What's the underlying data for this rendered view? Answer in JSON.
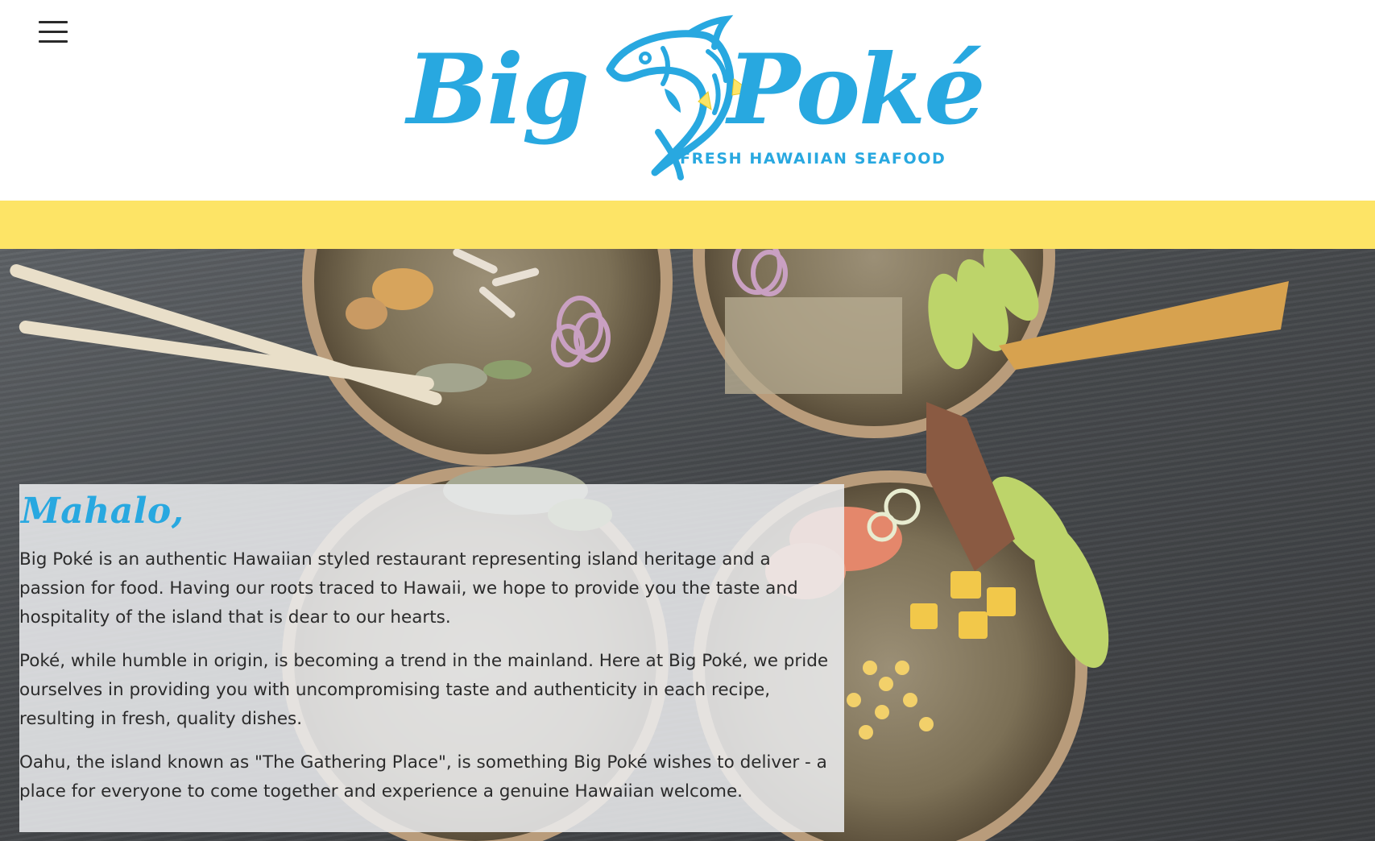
{
  "header": {
    "menu_icon": "hamburger-menu-icon",
    "logo": {
      "word_left": "Big",
      "word_right": "Poké",
      "tagline": "FRESH HAWAIIAN SEAFOOD",
      "fish_icon": "fish-logo-icon"
    }
  },
  "colors": {
    "brand_blue": "#28a8e0",
    "band_yellow": "#fde466",
    "panel_bg": "#eceef0",
    "text": "#2b2b2b"
  },
  "about": {
    "heading": "Mahalo,",
    "paragraphs": [
      "Big Poké is an authentic Hawaiian styled restaurant representing island heritage and a passion for food. Having our roots traced to Hawaii, we hope to provide you the taste and hospitality of the island that is dear to our hearts.",
      "Poké, while humble in origin, is becoming a trend in the mainland. Here at Big Poké, we pride ourselves in providing you with uncompromising taste and authenticity in each recipe, resulting in fresh, quality dishes.",
      "Oahu, the island known as \"The Gathering Place\", is something Big Poké wishes to deliver - a place for everyone to come together and experience a genuine Hawaiian welcome."
    ]
  }
}
